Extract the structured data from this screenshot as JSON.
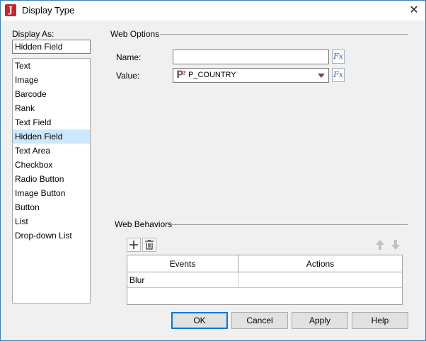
{
  "window": {
    "title": "Display Type",
    "app_icon_letter": "J"
  },
  "display_as": {
    "label": "Display As:",
    "current_value": "Hidden Field",
    "items": [
      {
        "label": "Text"
      },
      {
        "label": "Image"
      },
      {
        "label": "Barcode"
      },
      {
        "label": "Rank"
      },
      {
        "label": "Text Field"
      },
      {
        "label": "Hidden Field",
        "selected": true
      },
      {
        "label": "Text Area"
      },
      {
        "label": "Checkbox"
      },
      {
        "label": "Radio Button"
      },
      {
        "label": "Image Button"
      },
      {
        "label": "Button"
      },
      {
        "label": "List"
      },
      {
        "label": "Drop-down List"
      }
    ]
  },
  "web_options": {
    "title": "Web Options",
    "name_label": "Name:",
    "name_value": "",
    "value_label": "Value:",
    "value_selected": "P_COUNTRY",
    "fx_label": "Fx"
  },
  "web_behaviors": {
    "title": "Web Behaviors",
    "columns": [
      "Events",
      "Actions"
    ],
    "rows": [
      {
        "event": "Blur",
        "action": ""
      }
    ]
  },
  "buttons": {
    "ok": "OK",
    "cancel": "Cancel",
    "apply": "Apply",
    "help": "Help"
  },
  "colors": {
    "selection": "#cce8ff",
    "accent": "#0078d7",
    "brand": "#c8262b",
    "fx": "#2a6db8"
  }
}
